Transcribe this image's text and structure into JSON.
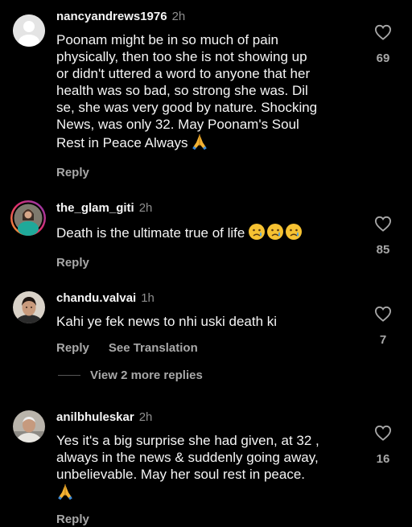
{
  "theme": {
    "background": "#000000",
    "text": "#f5f5f5",
    "muted": "#a8a8a8",
    "accent_ring": "#c13584"
  },
  "comments": [
    {
      "username": "nancyandrews1976",
      "time": "2h",
      "lines": "Poonam might be in so much of pain\nphysically, then too she is not showing up\nor didn't uttered a word to anyone that her\nhealth was so bad, so strong she was. Dil\nse, she was very good by nature. Shocking\nNews, was only 32. May Poonam's Soul\nRest in Peace Always",
      "emoji": "folded-hands",
      "reply_label": "Reply",
      "likes": "69",
      "avatar_icon": "default-avatar-icon"
    },
    {
      "username": "the_glam_giti",
      "time": "2h",
      "lines": "Death is the ultimate true of life",
      "emoji": "crying-faces",
      "reply_label": "Reply",
      "likes": "85",
      "avatar_icon": "story-ring-avatar"
    },
    {
      "username": "chandu.valvai",
      "time": "1h",
      "lines": "Kahi ye fek news to nhi uski death ki",
      "reply_label": "Reply",
      "translation_label": "See Translation",
      "likes": "7",
      "avatar_icon": "photo-avatar"
    },
    {
      "username": "anilbhuleskar",
      "time": "2h",
      "lines": "Yes it's a big surprise she had given, at 32 ,\nalways in the news & suddenly going away,\nunbelievable. May her soul rest in peace.",
      "emoji": "folded-hands",
      "reply_label": "Reply",
      "likes": "16",
      "avatar_icon": "photo-avatar"
    }
  ],
  "view_more_replies": "View 2 more replies",
  "icons": {
    "like": "heart-outline-icon"
  }
}
